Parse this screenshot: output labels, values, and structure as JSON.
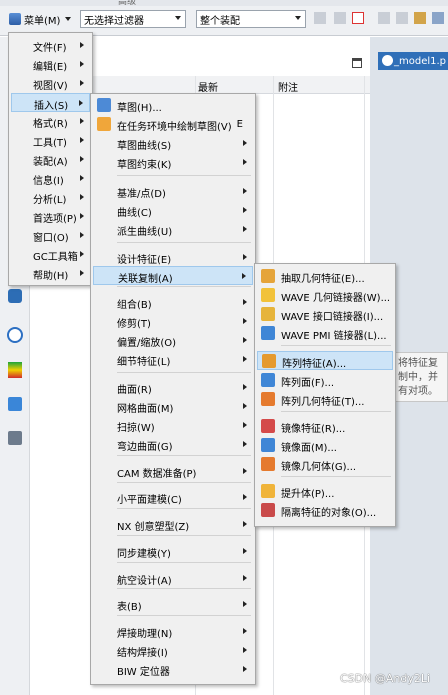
{
  "toolbar": {
    "menu_label": "菜单(M)",
    "filter_combo": "无选择过滤器",
    "assembly_combo": "整个装配",
    "top_fragment": "高级"
  },
  "nav": {
    "col_latest": "最新",
    "col_notes": "附注"
  },
  "tab": {
    "title": "_model1.p"
  },
  "main_menu": {
    "items": [
      {
        "label": "文件(F)",
        "submenu": true
      },
      {
        "label": "编辑(E)",
        "submenu": true
      },
      {
        "label": "视图(V)",
        "submenu": true
      },
      {
        "label": "插入(S)",
        "submenu": true,
        "highlighted": true
      },
      {
        "label": "格式(R)",
        "submenu": true
      },
      {
        "label": "工具(T)",
        "submenu": true
      },
      {
        "label": "装配(A)",
        "submenu": true
      },
      {
        "label": "信息(I)",
        "submenu": true
      },
      {
        "label": "分析(L)",
        "submenu": true
      },
      {
        "label": "首选项(P)",
        "submenu": true
      },
      {
        "label": "窗口(O)",
        "submenu": true
      },
      {
        "label": "GC工具箱",
        "submenu": true
      },
      {
        "label": "帮助(H)",
        "submenu": true
      }
    ]
  },
  "insert_menu": {
    "items": [
      {
        "label": "草图(H)...",
        "icon": "sketch-icon"
      },
      {
        "label": "在任务环境中绘制草图(V)",
        "icon": "task-sketch-icon",
        "accel": "E"
      },
      {
        "label": "草图曲线(S)",
        "submenu": true
      },
      {
        "label": "草图约束(K)",
        "submenu": true
      },
      {
        "label": "基准/点(D)",
        "submenu": true
      },
      {
        "label": "曲线(C)",
        "submenu": true
      },
      {
        "label": "派生曲线(U)",
        "submenu": true
      },
      {
        "label": "设计特征(E)",
        "submenu": true
      },
      {
        "label": "关联复制(A)",
        "submenu": true,
        "highlighted": true
      },
      {
        "label": "组合(B)",
        "submenu": true
      },
      {
        "label": "修剪(T)",
        "submenu": true
      },
      {
        "label": "偏置/缩放(O)",
        "submenu": true
      },
      {
        "label": "细节特征(L)",
        "submenu": true
      },
      {
        "label": "曲面(R)",
        "submenu": true
      },
      {
        "label": "网格曲面(M)",
        "submenu": true
      },
      {
        "label": "扫掠(W)",
        "submenu": true
      },
      {
        "label": "弯边曲面(G)",
        "submenu": true
      },
      {
        "label": "CAM 数据准备(P)",
        "submenu": true
      },
      {
        "label": "小平面建模(C)",
        "submenu": true
      },
      {
        "label": "NX 创意塑型(Z)",
        "submenu": true
      },
      {
        "label": "同步建模(Y)",
        "submenu": true
      },
      {
        "label": "航空设计(A)",
        "submenu": true
      },
      {
        "label": "表(B)",
        "submenu": true
      },
      {
        "label": "焊接助理(N)",
        "submenu": true
      },
      {
        "label": "结构焊接(I)",
        "submenu": true
      },
      {
        "label": "BIW 定位器",
        "submenu": true
      }
    ]
  },
  "assoc_menu": {
    "items": [
      {
        "label": "抽取几何特征(E)...",
        "icon": "extract-geometry-icon"
      },
      {
        "label": "WAVE 几何链接器(W)...",
        "icon": "wave-linker-icon"
      },
      {
        "label": "WAVE 接口链接器(I)...",
        "icon": "wave-interface-icon"
      },
      {
        "label": "WAVE PMI 链接器(L)...",
        "icon": "wave-pmi-icon"
      },
      {
        "label": "阵列特征(A)...",
        "icon": "pattern-feature-icon",
        "highlighted": true
      },
      {
        "label": "阵列面(F)...",
        "icon": "pattern-face-icon"
      },
      {
        "label": "阵列几何特征(T)...",
        "icon": "pattern-geometry-icon"
      },
      {
        "label": "镜像特征(R)...",
        "icon": "mirror-feature-icon"
      },
      {
        "label": "镜像面(M)...",
        "icon": "mirror-face-icon"
      },
      {
        "label": "镜像几何体(G)...",
        "icon": "mirror-geometry-icon"
      },
      {
        "label": "提升体(P)...",
        "icon": "promote-body-icon"
      },
      {
        "label": "隔离特征的对象(O)...",
        "icon": "isolate-object-icon"
      }
    ]
  },
  "tooltip": {
    "text": "将特征复制中，并有对项。"
  },
  "watermark": "CSDN @Andy2Li"
}
